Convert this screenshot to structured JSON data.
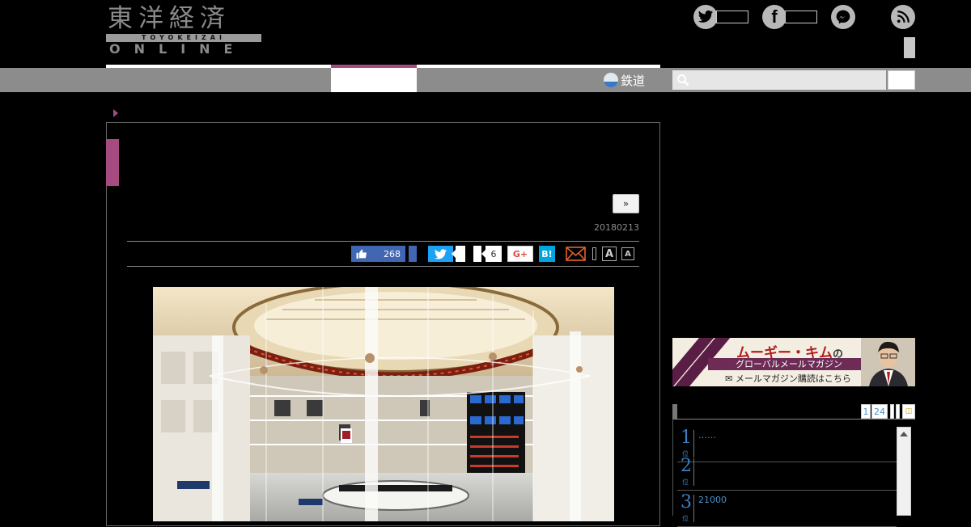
{
  "header": {
    "logo_kanji": "東洋経済",
    "logo_band": "TOYOKEIZAI",
    "logo_online": "ONLINE",
    "social": [
      {
        "name": "twitter",
        "icon": "twitter-bird-icon"
      },
      {
        "name": "facebook",
        "icon": "facebook-f-icon"
      },
      {
        "name": "messenger",
        "icon": "messenger-icon"
      },
      {
        "name": "rss",
        "icon": "rss-icon"
      }
    ]
  },
  "nav": {
    "railway_label": "鉄道",
    "search_placeholder": ""
  },
  "article": {
    "more_label": "»",
    "date": "20180213",
    "share": {
      "like_count": "268",
      "pocket_count": "6",
      "gplus_label": "G+",
      "hatena_label": "B!"
    },
    "font_large_label": "A",
    "font_small_label": "A"
  },
  "sidebar": {
    "ad": {
      "title": "ムーギー・キム",
      "title_suffix": "の",
      "subtitle": "グローバルメールマガジン",
      "cta": "✉ メールマガジン購読はこちら"
    },
    "ranking": {
      "tabs": [
        "1",
        "24"
      ],
      "rows": [
        {
          "rank": "1",
          "unit": "位",
          "text": "……"
        },
        {
          "rank": "2",
          "unit": "位",
          "text": ""
        },
        {
          "rank": "3",
          "unit": "位",
          "text": "21000"
        }
      ]
    }
  },
  "colors": {
    "accent": "#a54b80",
    "nav_gray": "#8c8c8c",
    "facebook": "#4267b2",
    "twitter": "#1da1f2",
    "hatena": "#00a4de",
    "ranking_blue": "#3a7fc0"
  }
}
